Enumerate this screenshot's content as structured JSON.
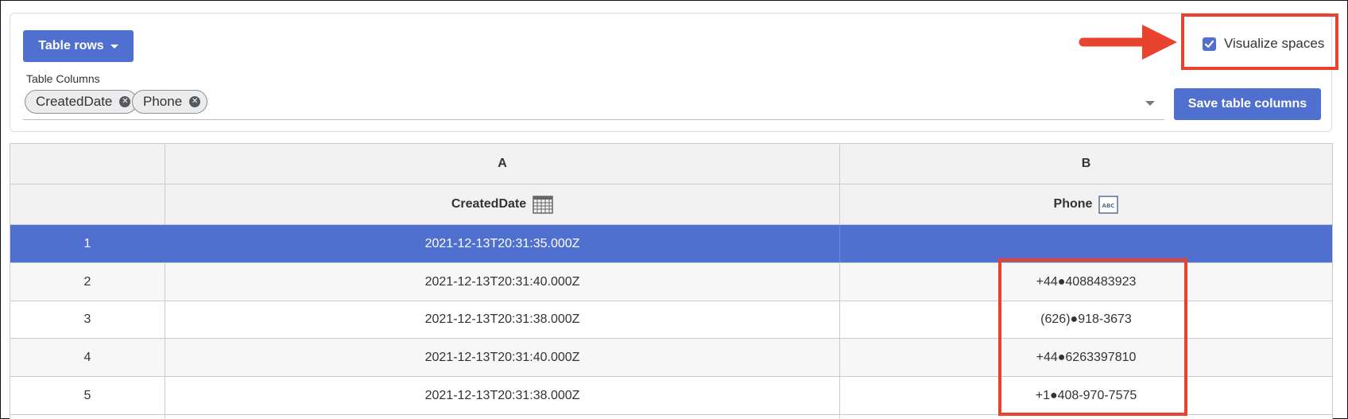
{
  "toolbar": {
    "table_rows_label": "Table rows",
    "columns_label": "Table Columns",
    "tags": [
      "CreatedDate",
      "Phone"
    ],
    "save_label": "Save table columns",
    "visualize_label": "Visualize spaces",
    "visualize_checked": true
  },
  "table": {
    "letters": [
      "A",
      "B"
    ],
    "columns": [
      {
        "name": "CreatedDate",
        "icon": "calendar-icon"
      },
      {
        "name": "Phone",
        "icon": "abc-text-icon"
      }
    ],
    "rows": [
      {
        "index": "1",
        "created": "2021-12-13T20:31:35.000Z",
        "phone": ""
      },
      {
        "index": "2",
        "created": "2021-12-13T20:31:40.000Z",
        "phone": "+44●4088483923"
      },
      {
        "index": "3",
        "created": "2021-12-13T20:31:38.000Z",
        "phone": "(626)●918-3673"
      },
      {
        "index": "4",
        "created": "2021-12-13T20:31:40.000Z",
        "phone": "+44●6263397810"
      },
      {
        "index": "5",
        "created": "2021-12-13T20:31:38.000Z",
        "phone": "+1●408-970-7575"
      }
    ]
  },
  "colors": {
    "accent": "#4f70cf",
    "annotation": "#e8432e"
  }
}
